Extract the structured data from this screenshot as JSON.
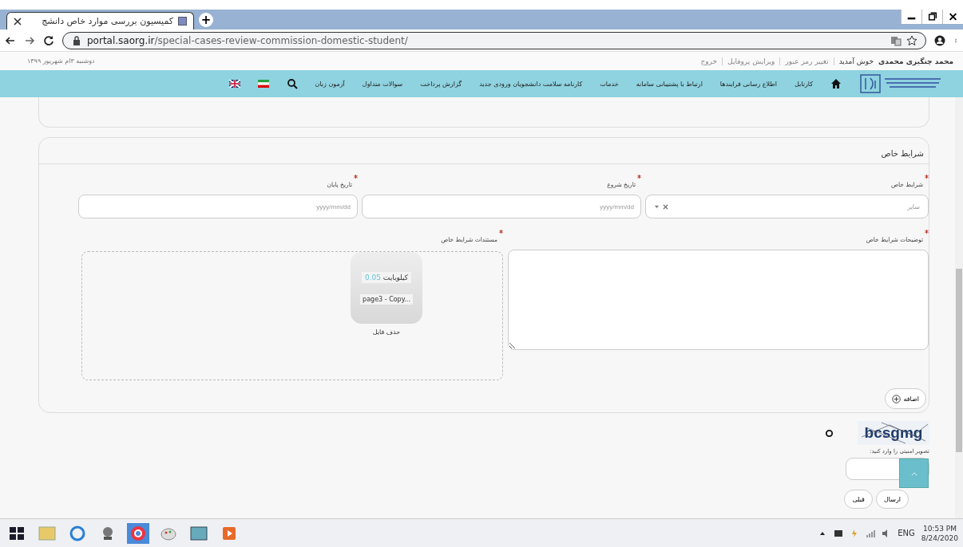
{
  "browser": {
    "tab_title": "کمیسیون بررسی موارد خاص دانشج",
    "new_tab": "+",
    "url_host": "portal.saorg.ir",
    "url_path": "/special-cases-review-commission-domestic-student/"
  },
  "top_bar": {
    "date": "دوشنبه ۳ام شهریور ۱۳۹۹",
    "user_name": "محمد چنگیزی محمدی",
    "welcome": "خوش آمدید",
    "links": [
      "تغییر رمز عبور",
      "ویرایش پروفایل",
      "خروج"
    ]
  },
  "nav": {
    "items": [
      "کارتابل",
      "اطلاع رسانی فرایندها",
      "ارتباط با پشتیبانی سامانه",
      "خدمات",
      "کارنامه سلامت دانشجویان ورودی جدید",
      "گزارش پرداخت",
      "سوالات متداول",
      "آزمون زبان"
    ]
  },
  "section": {
    "title": "شرایط خاص",
    "fields": [
      {
        "kind": "select",
        "label": "شرایط خاص",
        "required": true,
        "value": "سایر"
      },
      {
        "kind": "date",
        "label": "تاریخ شروع",
        "required": true,
        "placeholder": "yyyy/mm/dd"
      },
      {
        "kind": "date",
        "label": "تاریخ پایان",
        "required": true,
        "placeholder": "yyyy/mm/dd"
      }
    ],
    "description": {
      "label": "توضیحات شرایط خاص",
      "required": true
    },
    "documents": {
      "label": "مستندات شرایط خاص",
      "required": true,
      "file": {
        "unit": "کیلوبایت",
        "size": "0.05",
        "name": "page3 - Copy...",
        "remove": "حذف فایل"
      }
    },
    "add_button": "اضافه"
  },
  "captcha": {
    "text": "bcsgmg",
    "label": "تصویر امنیتی را وارد کنید:"
  },
  "buttons": [
    "ارسال",
    "قبلی"
  ],
  "taskbar": {
    "language": "ENG",
    "time": "10:53 PM",
    "date": "8/24/2020"
  }
}
